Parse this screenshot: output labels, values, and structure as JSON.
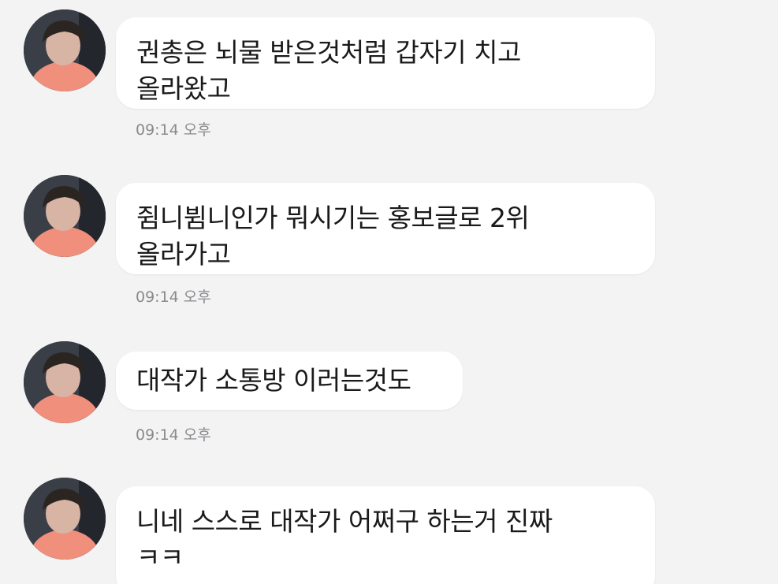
{
  "messages": [
    {
      "text": "권총은 뇌물 받은것처럼 갑자기 치고\n올라왔고",
      "time": "09:14 오후"
    },
    {
      "text": "쥠니뷤니인가 뭐시기는 홍보글로 2위\n올라가고",
      "time": "09:14 오후"
    },
    {
      "text": "대작가 소통방 이러는것도",
      "time": "09:14 오후"
    },
    {
      "text": "니네 스스로 대작가 어쩌구 하는거 진짜\nㅋㅋ",
      "time": ""
    }
  ],
  "colors": {
    "background": "#f3f3f4",
    "bubble": "#ffffff",
    "text": "#1a1a1a",
    "timestamp": "#8a8a8e"
  },
  "icons": {
    "avatar": "profile-photo"
  }
}
